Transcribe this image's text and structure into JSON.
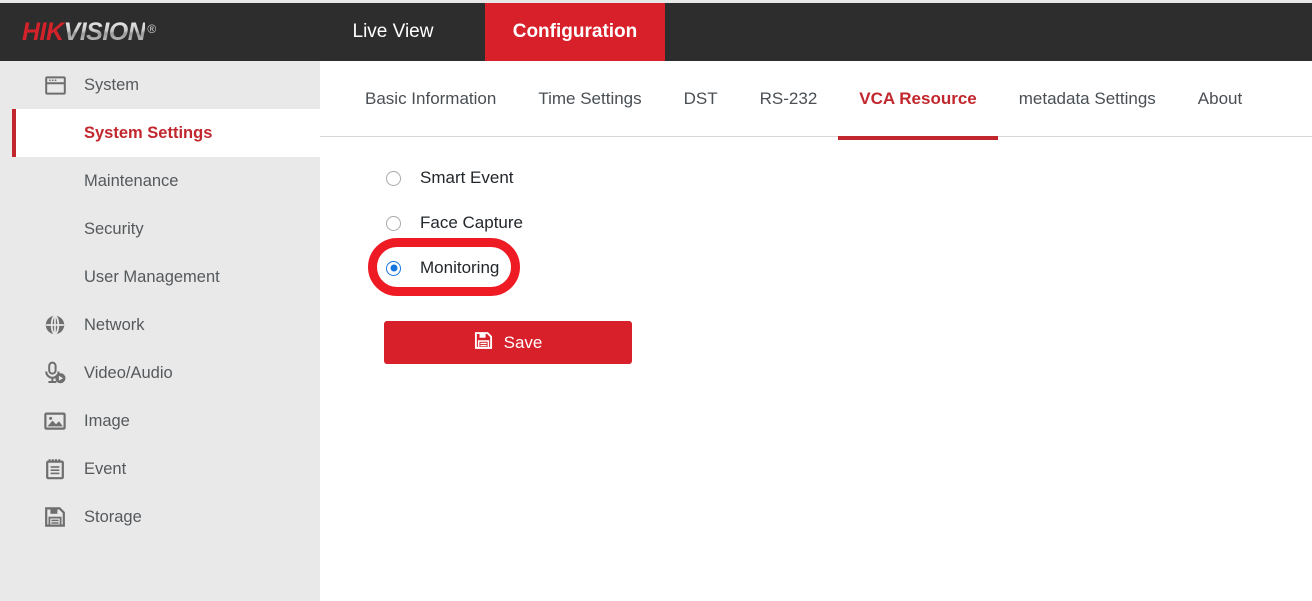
{
  "brand": {
    "logo_hik": "HIK",
    "logo_vision": "VISION",
    "logo_registered": "®",
    "accent_red": "#c1272d",
    "header_red": "#d8202a",
    "header_bg": "#2d2d2d",
    "sidebar_bg": "#e9e9e9",
    "annotation_red": "#ee1b24",
    "radio_blue": "#1675e0"
  },
  "header": {
    "nav": [
      {
        "label": "Live View",
        "active": false
      },
      {
        "label": "Configuration",
        "active": true
      }
    ]
  },
  "sidebar": {
    "items": [
      {
        "label": "System",
        "icon": "window-icon",
        "type": "group",
        "active": false
      },
      {
        "label": "System Settings",
        "icon": "",
        "type": "sub",
        "active": true
      },
      {
        "label": "Maintenance",
        "icon": "",
        "type": "sub",
        "active": false
      },
      {
        "label": "Security",
        "icon": "",
        "type": "sub",
        "active": false
      },
      {
        "label": "User Management",
        "icon": "",
        "type": "sub",
        "active": false
      },
      {
        "label": "Network",
        "icon": "globe-icon",
        "type": "group",
        "active": false
      },
      {
        "label": "Video/Audio",
        "icon": "microphone-icon",
        "type": "group",
        "active": false
      },
      {
        "label": "Image",
        "icon": "picture-icon",
        "type": "group",
        "active": false
      },
      {
        "label": "Event",
        "icon": "notepad-icon",
        "type": "group",
        "active": false
      },
      {
        "label": "Storage",
        "icon": "floppy-icon",
        "type": "group",
        "active": false
      }
    ]
  },
  "main": {
    "tabs": [
      {
        "label": "Basic Information",
        "active": false
      },
      {
        "label": "Time Settings",
        "active": false
      },
      {
        "label": "DST",
        "active": false
      },
      {
        "label": "RS-232",
        "active": false
      },
      {
        "label": "VCA Resource",
        "active": true
      },
      {
        "label": "metadata Settings",
        "active": false
      },
      {
        "label": "About",
        "active": false
      }
    ],
    "vca_resource": {
      "options": [
        {
          "label": "Smart Event",
          "selected": false,
          "highlighted": false
        },
        {
          "label": "Face Capture",
          "selected": false,
          "highlighted": false
        },
        {
          "label": "Monitoring",
          "selected": true,
          "highlighted": true
        }
      ],
      "selected_value": "Monitoring",
      "save_label": "Save",
      "save_icon": "floppy-save-icon"
    }
  }
}
